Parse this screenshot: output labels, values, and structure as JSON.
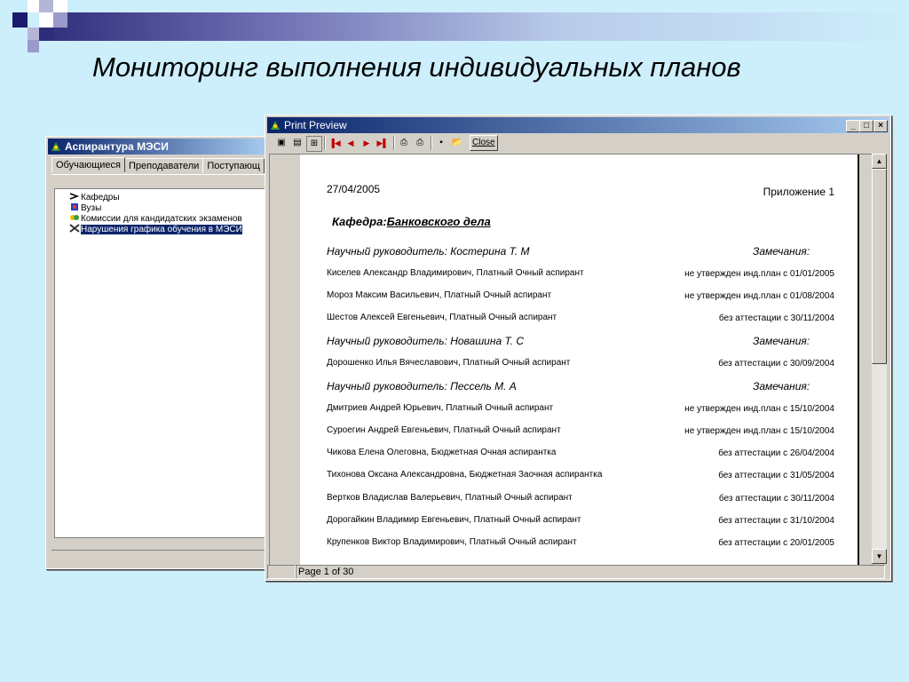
{
  "slide": {
    "title": "Мониторинг выполнения индивидуальных планов"
  },
  "back_window": {
    "title": "Аспирантура МЭСИ",
    "tabs": [
      "Обучающиеся",
      "Преподаватели",
      "Поступающ"
    ],
    "tree_items": [
      {
        "label": "Кафедры",
        "icon": "folder-arrow-icon"
      },
      {
        "label": "Вузы",
        "icon": "university-icon"
      },
      {
        "label": "Комиссии для кандидатских экзаменов",
        "icon": "commission-icon"
      },
      {
        "label": "Нарушения графика обучения в МЭСИ",
        "icon": "violation-icon"
      }
    ]
  },
  "front_window": {
    "title": "Print Preview",
    "buttons": {
      "minimize": "_",
      "maximize": "□",
      "close": "×"
    },
    "toolbar": {
      "close_label": "Close"
    },
    "status": "Page 1 of 30"
  },
  "report": {
    "date": "27/04/2005",
    "appendix": "Приложение 1",
    "dept_prefix": "Кафедра:",
    "dept_name": "Банковского дела",
    "remarks_label": "Замечания:",
    "groups": [
      {
        "supervisor": "Научный руководитель:  Костерина Т. М",
        "students": [
          {
            "name": "Киселев Александр Владимирович, Платный Очный аспирант",
            "note": "не утвержден инд.план  с  01/01/2005"
          },
          {
            "name": "Мороз Максим Васильевич, Платный Очный аспирант",
            "note": "не утвержден инд.план  с  01/08/2004"
          },
          {
            "name": "Шестов Алексей Евгеньевич, Платный Очный аспирант",
            "note": "без аттестации  с  30/11/2004"
          }
        ]
      },
      {
        "supervisor": "Научный руководитель:  Новашина Т. С",
        "students": [
          {
            "name": "Дорошенко Илья Вячеславович, Платный Очный аспирант",
            "note": "без аттестации  с  30/09/2004"
          }
        ]
      },
      {
        "supervisor": "Научный руководитель:  Пессель М. А",
        "students": [
          {
            "name": "Дмитриев Андрей Юрьевич, Платный Очный аспирант",
            "note": "не утвержден инд.план  с  15/10/2004"
          },
          {
            "name": "Суроегин Андрей Евгеньевич, Платный Очный аспирант",
            "note": "не утвержден инд.план  с  15/10/2004"
          },
          {
            "name": "Чикова Елена Олеговна, Бюджетная Очная аспирантка",
            "note": "без аттестации  с  26/04/2004"
          },
          {
            "name": "Тихонова Оксана Александровна, Бюджетная Заочная аспирантка",
            "note": "без аттестации  с  31/05/2004"
          },
          {
            "name": "Вертков Владислав  Валерьевич, Платный Очный аспирант",
            "note": "без аттестации  с  30/11/2004"
          },
          {
            "name": "Дорогайкин Владимир Евгеньевич, Платный Очный аспирант",
            "note": "без аттестации  с  31/10/2004"
          },
          {
            "name": "Крупенков Виктор Владимирович, Платный Очный аспирант",
            "note": "без аттестации  с  20/01/2005"
          }
        ]
      }
    ]
  },
  "colors": {
    "background": "#cdeefb",
    "titlebar": "#0a246a",
    "selection": "#0a246a"
  }
}
